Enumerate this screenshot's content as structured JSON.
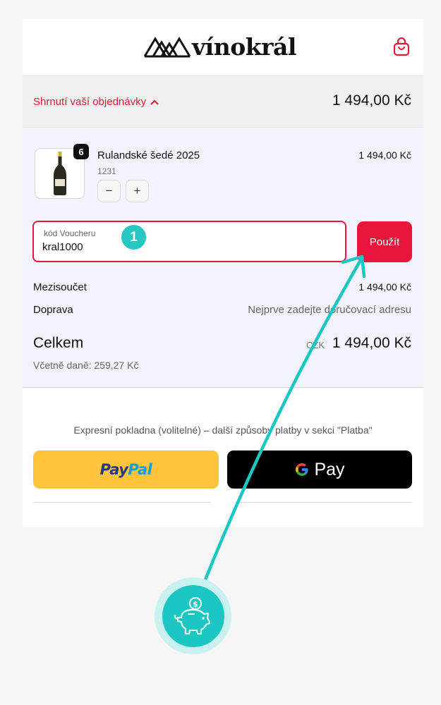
{
  "header": {
    "brand": "vínokrál",
    "bag_icon": "shopping-bag-icon"
  },
  "summary": {
    "toggle_label": "Shrnutí vaší objednávky",
    "toggle_icon": "chevron-up-icon",
    "total": "1 494,00 Kč"
  },
  "cart": {
    "item": {
      "quantity": "6",
      "name": "Rulandské šedé 2025",
      "code": "1231",
      "price": "1 494,00 Kč",
      "minus_label": "−",
      "plus_label": "+",
      "image": "wine-bottle-icon"
    }
  },
  "voucher": {
    "label": "kód Voucheru",
    "value": "kral1000",
    "step_number": "1",
    "apply_label": "Použít"
  },
  "totals": {
    "subtotal_label": "Mezisoučet",
    "subtotal_value": "1 494,00 Kč",
    "shipping_label": "Doprava",
    "shipping_value": "Nejprve zadejte doručovací adresu",
    "total_label": "Celkem",
    "currency": "CZK",
    "total_value": "1 494,00 Kč",
    "tax_note": "Včetně daně: 259,27 Kč"
  },
  "express": {
    "text": "Expresní pokladna (volitelné) – další způsoby platby v sekci \"Platba\"",
    "paypal_part1": "Pay",
    "paypal_part2": "Pal",
    "gpay_label": "Pay"
  },
  "colors": {
    "accent": "#e8163a",
    "teal": "#1cc7c3",
    "paypal": "#ffc439"
  },
  "annotation_icon": "piggy-bank-coin-icon"
}
